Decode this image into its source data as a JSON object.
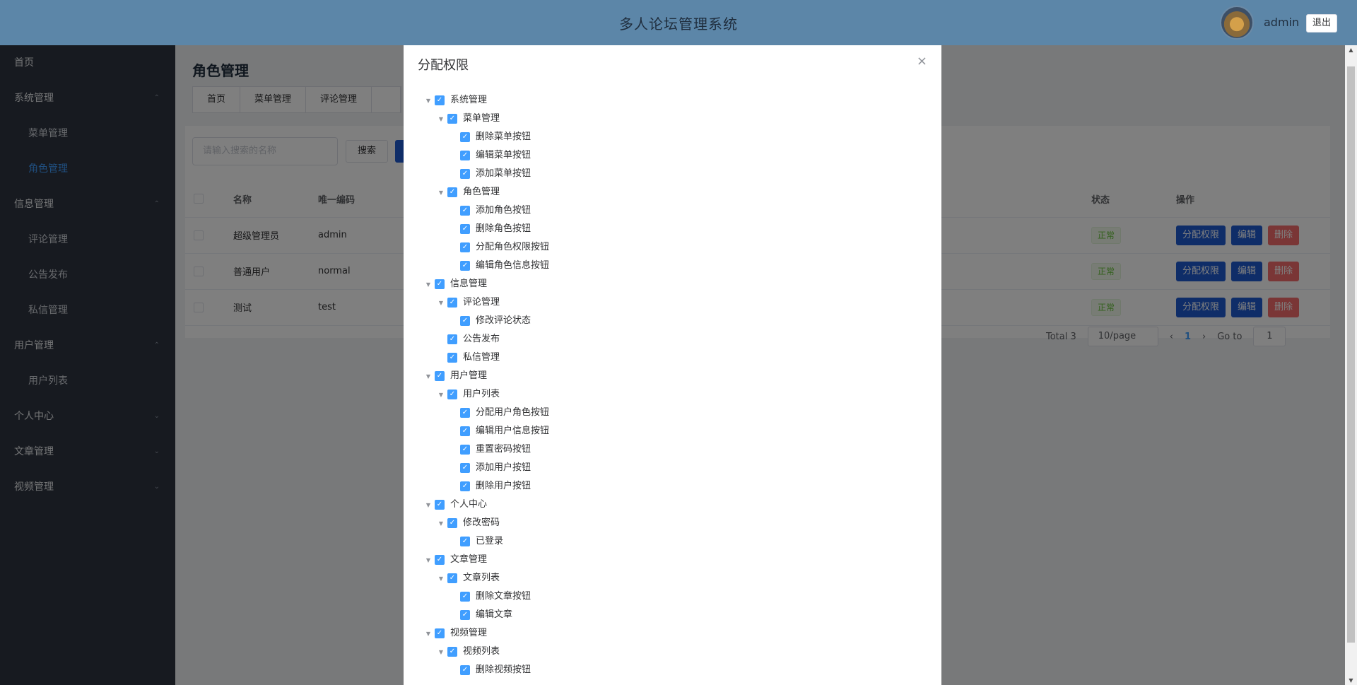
{
  "header": {
    "title": "多人论坛管理系统",
    "user": "admin",
    "logout": "退出"
  },
  "sidebar": [
    {
      "label": "首页",
      "type": "item"
    },
    {
      "label": "系统管理",
      "type": "group",
      "chev": "⌃"
    },
    {
      "label": "菜单管理",
      "type": "sub"
    },
    {
      "label": "角色管理",
      "type": "sub-active"
    },
    {
      "label": "信息管理",
      "type": "group",
      "chev": "⌃"
    },
    {
      "label": "评论管理",
      "type": "sub"
    },
    {
      "label": "公告发布",
      "type": "sub"
    },
    {
      "label": "私信管理",
      "type": "sub"
    },
    {
      "label": "用户管理",
      "type": "group",
      "chev": "⌃"
    },
    {
      "label": "用户列表",
      "type": "sub"
    },
    {
      "label": "个人中心",
      "type": "group",
      "chev": "⌄"
    },
    {
      "label": "文章管理",
      "type": "group",
      "chev": "⌄"
    },
    {
      "label": "视频管理",
      "type": "group",
      "chev": "⌄"
    }
  ],
  "page": {
    "title": "角色管理",
    "tabs": [
      "首页",
      "菜单管理",
      "评论管理",
      ""
    ]
  },
  "search": {
    "placeholder": "请输入搜索的名称",
    "button": "搜索"
  },
  "table": {
    "headers": [
      "名称",
      "唯一编码",
      "",
      "状态",
      "操作"
    ],
    "rows": [
      {
        "name": "超级管理员",
        "code": "admin",
        "status": "正常"
      },
      {
        "name": "普通用户",
        "code": "normal",
        "status": "正常"
      },
      {
        "name": "测试",
        "code": "test",
        "status": "正常"
      }
    ],
    "actions": {
      "assign": "分配权限",
      "edit": "编辑",
      "delete": "删除"
    }
  },
  "pager": {
    "total": "Total 3",
    "size": "10/page",
    "page": "1",
    "goto": "Go to",
    "goto_value": "1"
  },
  "dialog": {
    "title": "分配权限",
    "close": "×",
    "tree": [
      {
        "label": "系统管理",
        "level": 0,
        "expand": true
      },
      {
        "label": "菜单管理",
        "level": 1,
        "expand": true
      },
      {
        "label": "删除菜单按钮",
        "level": 2
      },
      {
        "label": "编辑菜单按钮",
        "level": 2
      },
      {
        "label": "添加菜单按钮",
        "level": 2
      },
      {
        "label": "角色管理",
        "level": 1,
        "expand": true
      },
      {
        "label": "添加角色按钮",
        "level": 2
      },
      {
        "label": "删除角色按钮",
        "level": 2
      },
      {
        "label": "分配角色权限按钮",
        "level": 2
      },
      {
        "label": "编辑角色信息按钮",
        "level": 2
      },
      {
        "label": "信息管理",
        "level": 0,
        "expand": true
      },
      {
        "label": "评论管理",
        "level": 1,
        "expand": true
      },
      {
        "label": "修改评论状态",
        "level": 2
      },
      {
        "label": "公告发布",
        "level": 1
      },
      {
        "label": "私信管理",
        "level": 1
      },
      {
        "label": "用户管理",
        "level": 0,
        "expand": true
      },
      {
        "label": "用户列表",
        "level": 1,
        "expand": true
      },
      {
        "label": "分配用户角色按钮",
        "level": 2
      },
      {
        "label": "编辑用户信息按钮",
        "level": 2
      },
      {
        "label": "重置密码按钮",
        "level": 2
      },
      {
        "label": "添加用户按钮",
        "level": 2
      },
      {
        "label": "删除用户按钮",
        "level": 2
      },
      {
        "label": "个人中心",
        "level": 0,
        "expand": true
      },
      {
        "label": "修改密码",
        "level": 1,
        "expand": true
      },
      {
        "label": "已登录",
        "level": 2
      },
      {
        "label": "文章管理",
        "level": 0,
        "expand": true
      },
      {
        "label": "文章列表",
        "level": 1,
        "expand": true
      },
      {
        "label": "删除文章按钮",
        "level": 2
      },
      {
        "label": "编辑文章",
        "level": 2
      },
      {
        "label": "视频管理",
        "level": 0,
        "expand": true
      },
      {
        "label": "视频列表",
        "level": 1,
        "expand": true
      },
      {
        "label": "删除视频按钮",
        "level": 2
      }
    ]
  }
}
